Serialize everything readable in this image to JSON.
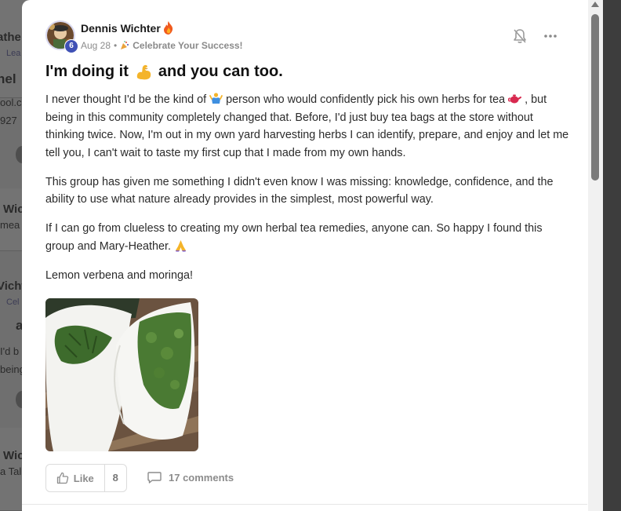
{
  "background_feed": {
    "fragments": [
      "athe",
      "Lea",
      "nel",
      "ool.c",
      "927",
      "Wic",
      "mea",
      "Vicht",
      "Cel",
      "a",
      "I'd b",
      "being",
      "Wic",
      "a Tal"
    ]
  },
  "post": {
    "author": {
      "name": "Dennis Wichter",
      "level": "6",
      "streak_icon": "fire-icon"
    },
    "date": "Aug 28",
    "separator": "•",
    "category": "Celebrate Your Success!",
    "title_before": "I'm doing it",
    "title_after": "and you can too.",
    "paragraphs": {
      "p1_a": "I never thought I'd be the kind of",
      "p1_b": "person who would confidently pick his own herbs for tea",
      "p1_c": ", but being in this community completely changed that. Before, I'd just buy tea bags at the store without thinking twice. Now, I'm out in my own yard harvesting herbs I can identify, prepare, and enjoy and let me tell you, I can't wait to taste my first cup that I made from my own hands.",
      "p2": "This group has given me something I didn't even know I was missing: knowledge, confidence, and the ability to use what nature already provides in the simplest, most powerful way.",
      "p3": "If I can go from clueless to creating my own herbal tea remedies, anyone can. So happy I found this group and Mary-Heather.",
      "p4": "Lemon verbena and moringa!"
    },
    "image_alt": "herbs in white cloth bags",
    "actions": {
      "like_label": "Like",
      "like_count": "8",
      "comments_label": "17 comments"
    }
  },
  "colors": {
    "accent_badge": "#3f51b5",
    "muted_text": "#8c8c8c",
    "overlay": "#3d3d3d"
  }
}
